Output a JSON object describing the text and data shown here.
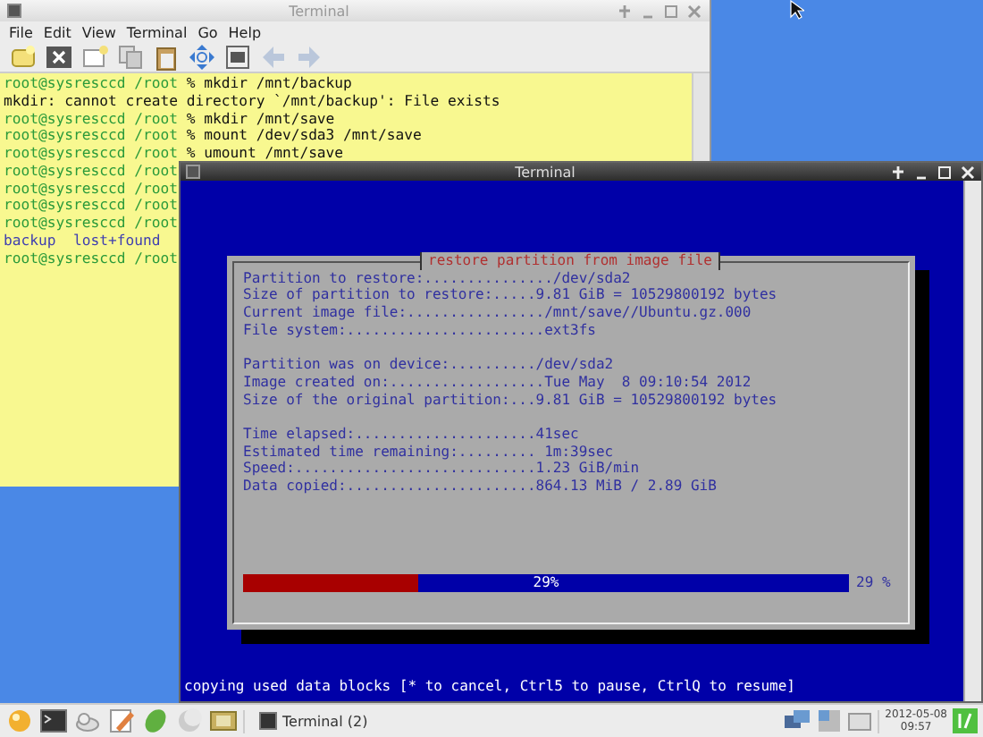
{
  "back_window": {
    "title": "Terminal",
    "menu": [
      "File",
      "Edit",
      "View",
      "Terminal",
      "Go",
      "Help"
    ],
    "toolbar": [
      {
        "kind": "new-tab",
        "disabled": false
      },
      {
        "kind": "close-tab",
        "disabled": false
      },
      {
        "kind": "new-window",
        "disabled": false
      },
      {
        "kind": "copy",
        "disabled": false
      },
      {
        "kind": "paste",
        "disabled": false
      },
      {
        "kind": "zoom",
        "disabled": false
      },
      {
        "kind": "terminal",
        "disabled": false
      },
      {
        "kind": "back",
        "disabled": true
      },
      {
        "kind": "forward",
        "disabled": true
      }
    ],
    "lines": [
      {
        "kind": "prompt",
        "prompt": "root@sysresccd /root",
        "command": "% mkdir /mnt/backup"
      },
      {
        "kind": "output",
        "text": "mkdir: cannot create directory `/mnt/backup': File exists"
      },
      {
        "kind": "prompt",
        "prompt": "root@sysresccd /root",
        "command": "% mkdir /mnt/save"
      },
      {
        "kind": "prompt",
        "prompt": "root@sysresccd /root",
        "command": "% mount /dev/sda3 /mnt/save"
      },
      {
        "kind": "prompt",
        "prompt": "root@sysresccd /root",
        "command": "% umount /mnt/save"
      },
      {
        "kind": "prompt",
        "prompt": "root@sysresccd /root"
      },
      {
        "kind": "prompt",
        "prompt": "root@sysresccd /root"
      },
      {
        "kind": "prompt",
        "prompt": "root@sysresccd /root"
      },
      {
        "kind": "prompt",
        "prompt": "root@sysresccd /root"
      },
      {
        "kind": "listing",
        "text": "backup  lost+found"
      },
      {
        "kind": "prompt",
        "prompt": "root@sysresccd /root"
      }
    ]
  },
  "front_window": {
    "title": "Terminal",
    "dialog": {
      "title": "restore partition from image file",
      "sections": [
        [
          "Partition to restore:.............../dev/sda2",
          "Size of partition to restore:.....9.81 GiB = 10529800192 bytes",
          "Current image file:................/mnt/save//Ubuntu.gz.000",
          "File system:.......................ext3fs"
        ],
        [
          "Partition was on device:........../dev/sda2",
          "Image created on:..................Tue May  8 09:10:54 2012",
          "Size of the original partition:...9.81 GiB = 10529800192 bytes"
        ],
        [
          "Time elapsed:.....................41sec",
          "Estimated time remaining:......... 1m:39sec",
          "Speed:............................1.23 GiB/min",
          "Data copied:......................864.13 MiB / 2.89 GiB"
        ]
      ],
      "progress": {
        "level": 0.29,
        "label": "29%",
        "reading": "29 %"
      }
    },
    "status_line": "copying used data blocks [* to cancel, Ctrl5 to pause, CtrlQ to resume]"
  },
  "taskbar": {
    "launchers": [
      {
        "kind": "menu"
      },
      {
        "kind": "terminal"
      },
      {
        "kind": "files"
      },
      {
        "kind": "editor"
      },
      {
        "kind": "leaf"
      },
      {
        "kind": "moon"
      },
      {
        "kind": "desktop"
      }
    ],
    "tasks": [
      {
        "label": "Terminal (2)",
        "selected": false
      }
    ],
    "clock": {
      "date": "2012-05-08",
      "time": "09:57"
    }
  }
}
